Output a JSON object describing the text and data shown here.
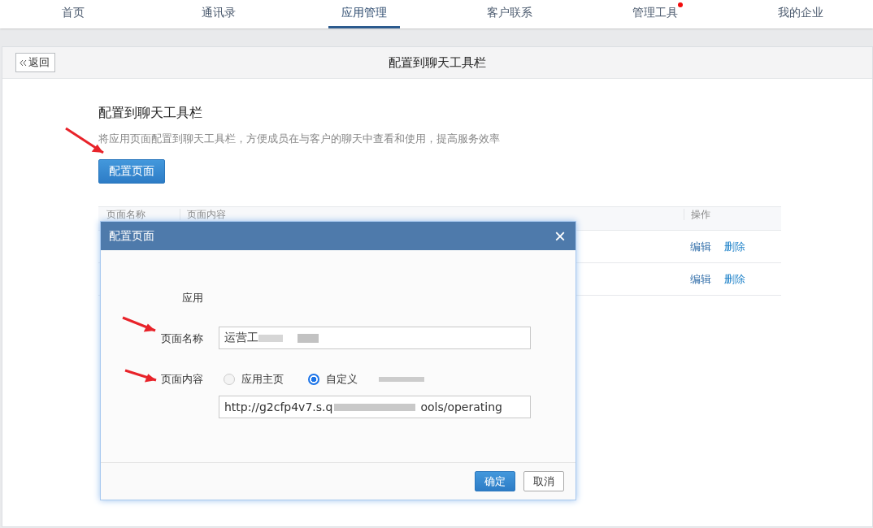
{
  "nav": {
    "tabs": [
      {
        "label": "首页",
        "selected": false,
        "badge": false
      },
      {
        "label": "通讯录",
        "selected": false,
        "badge": false
      },
      {
        "label": "应用管理",
        "selected": true,
        "badge": false
      },
      {
        "label": "客户联系",
        "selected": false,
        "badge": false
      },
      {
        "label": "管理工具",
        "selected": false,
        "badge": true
      },
      {
        "label": "我的企业",
        "selected": false,
        "badge": false
      }
    ]
  },
  "panel": {
    "back": "返回",
    "title": "配置到聊天工具栏",
    "heading": "配置到聊天工具栏",
    "description": "将应用页面配置到聊天工具栏，方便成员在与客户的聊天中查看和使用，提高服务效率",
    "configure_button": "配置页面",
    "table": {
      "columns": [
        "页面名称",
        "页面内容",
        "操作"
      ],
      "rows": [
        {
          "actions": [
            "编辑",
            "删除"
          ]
        },
        {
          "actions": [
            "编辑",
            "删除"
          ]
        }
      ]
    }
  },
  "dialog": {
    "title": "配置页面",
    "close": "×",
    "app_label": "应用",
    "name_label": "页面名称",
    "name_value": "运营工",
    "content_label": "页面内容",
    "options": [
      {
        "label": "应用主页",
        "selected": false
      },
      {
        "label": "自定义",
        "selected": true
      }
    ],
    "url_start": "http://g2cfp4v7.s.q",
    "url_end": "ools/operating",
    "buttons": [
      {
        "label": "确定",
        "kind": "primary"
      },
      {
        "label": "取消",
        "kind": "secondary"
      }
    ]
  }
}
